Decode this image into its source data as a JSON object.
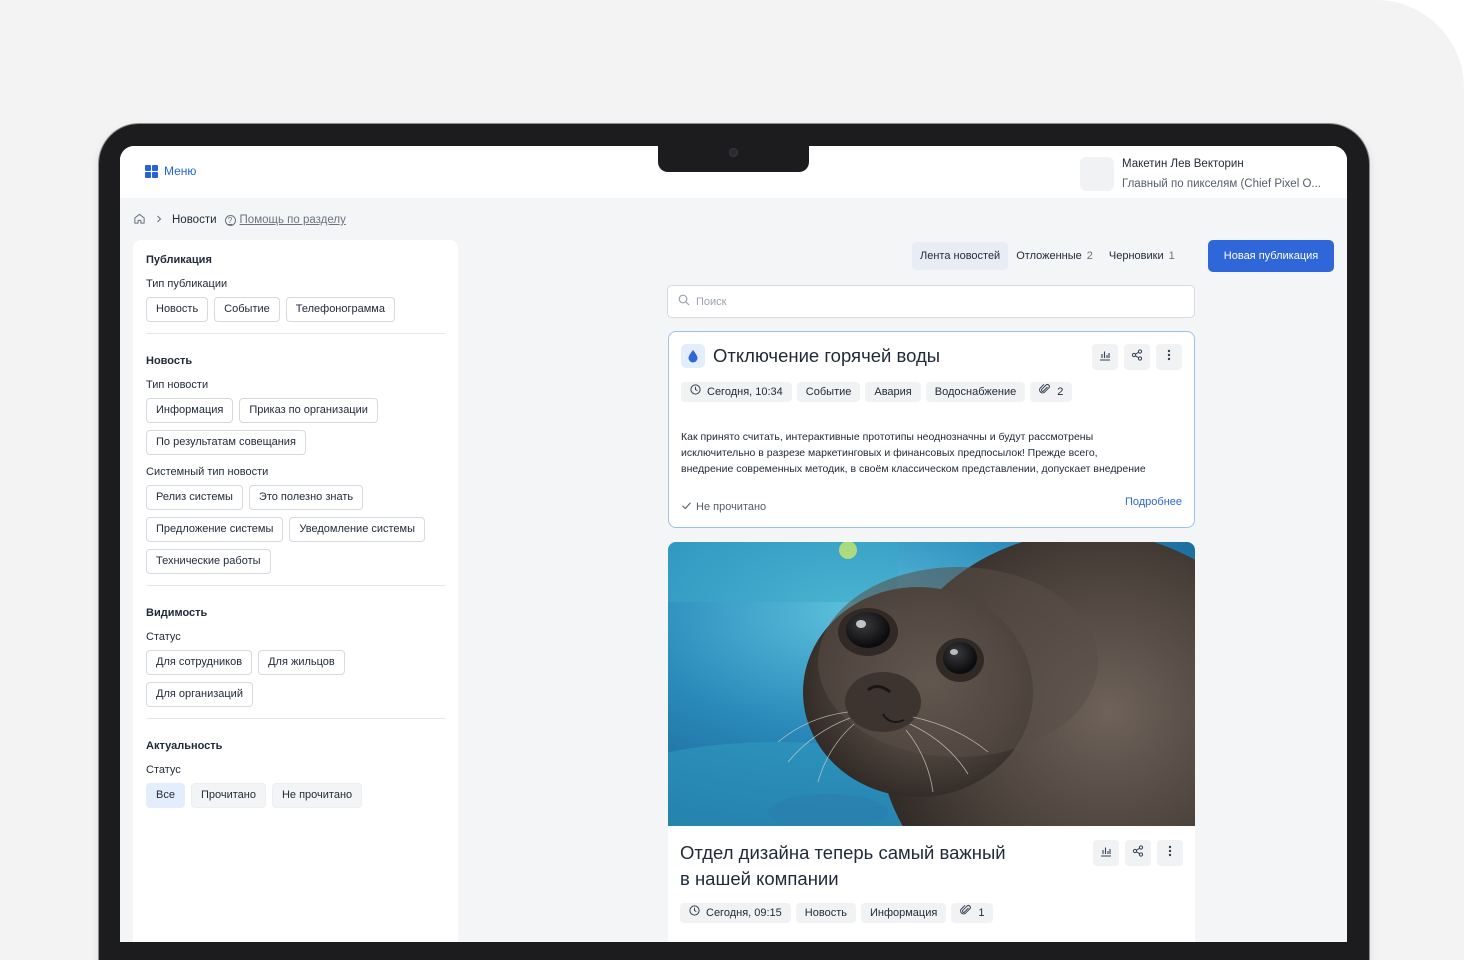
{
  "topbar": {
    "menu_label": "Меню",
    "user_name": "Макетин Лев Векторин",
    "user_role": "Главный по пикселям (Chief Pixel O..."
  },
  "breadcrumb": {
    "home_icon": "home-icon",
    "current": "Новости",
    "help_label": "Помощь по разделу"
  },
  "filters": {
    "publication": {
      "title": "Публикация",
      "type_label": "Тип публикации",
      "types": [
        "Новость",
        "Событие",
        "Телефонограмма"
      ]
    },
    "news": {
      "title": "Новость",
      "type_label": "Тип новости",
      "types": [
        "Информация",
        "Приказ по организации",
        "По результатам совещания"
      ],
      "system_type_label": "Системный тип новости",
      "system_types": [
        "Релиз системы",
        "Это полезно знать",
        "Предложение системы",
        "Уведомление системы",
        "Технические работы"
      ]
    },
    "visibility": {
      "title": "Видимость",
      "status_label": "Статус",
      "options": [
        "Для сотрудников",
        "Для жильцов",
        "Для организаций"
      ]
    },
    "relevance": {
      "title": "Актуальность",
      "status_label": "Статус",
      "options": [
        "Все",
        "Прочитано",
        "Не прочитано"
      ],
      "selected": "Все"
    }
  },
  "tabs": [
    {
      "label": "Лента новостей",
      "count": "",
      "active": true
    },
    {
      "label": "Отложенные",
      "count": "2",
      "active": false
    },
    {
      "label": "Черновики",
      "count": "1",
      "active": false
    }
  ],
  "new_button_label": "Новая публикация",
  "search": {
    "placeholder": "Поиск",
    "value": ""
  },
  "posts": [
    {
      "title": "Отключение горячей воды",
      "icon": "water-drop-icon",
      "date": "Сегодня, 10:34",
      "tags": [
        "Событие",
        "Авария",
        "Водоснабжение"
      ],
      "attachments": "2",
      "text": [
        "Как принято считать, интерактивные прототипы неоднозначны и будут рассмотрены",
        "исключительно в разрезе маркетинговых и финансовых предпосылок! Прежде всего,",
        "внедрение современных методик, в своём классическом представлении, допускает внедрение"
      ],
      "status": "Не прочитано",
      "more_label": "Подробнее"
    },
    {
      "title_lines": [
        "Отдел дизайна теперь самый важный",
        "в нашей компании"
      ],
      "date": "Сегодня, 09:15",
      "tags": [
        "Новость",
        "Информация"
      ],
      "attachments": "1"
    }
  ],
  "colors": {
    "accent": "#2f66d9",
    "active_chip": "#e3edfb",
    "card_border": "#9dc1ee"
  }
}
